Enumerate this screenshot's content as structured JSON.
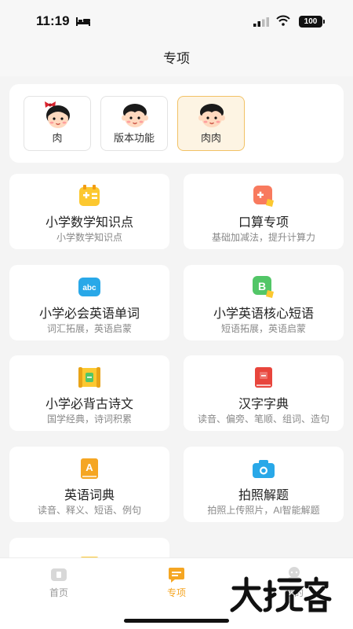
{
  "status_bar": {
    "time": "11:19",
    "battery": "100"
  },
  "nav": {
    "title": "专项"
  },
  "profiles": [
    {
      "label": "肉",
      "gender": "girl",
      "selected": false
    },
    {
      "label": "版本功能",
      "gender": "boy",
      "selected": false
    },
    {
      "label": "肉肉",
      "gender": "boy",
      "selected": true
    }
  ],
  "tiles": [
    {
      "title": "小学数学知识点",
      "subtitle": "小学数学知识点",
      "icon": "math-icon"
    },
    {
      "title": "口算专项",
      "subtitle": "基础加减法，提升计算力",
      "icon": "calc-icon"
    },
    {
      "title": "小学必会英语单词",
      "subtitle": "词汇拓展，英语启蒙",
      "icon": "abc-icon"
    },
    {
      "title": "小学英语核心短语",
      "subtitle": "短语拓展，英语启蒙",
      "icon": "phrase-b-icon"
    },
    {
      "title": "小学必背古诗文",
      "subtitle": "国学经典，诗词积累",
      "icon": "scroll-icon"
    },
    {
      "title": "汉字字典",
      "subtitle": "读音、偏旁、笔顺、组词、造句",
      "icon": "dictionary-icon"
    },
    {
      "title": "英语词典",
      "subtitle": "读音、释义、短语、例句",
      "icon": "english-dictionary-icon"
    },
    {
      "title": "拍照解题",
      "subtitle": "拍照上传照片，AI智能解题",
      "icon": "camera-icon"
    }
  ],
  "tab_bar": {
    "tabs": [
      {
        "label": "首页",
        "icon": "home-icon"
      },
      {
        "label": "专项",
        "icon": "special-icon"
      },
      {
        "label": "我的",
        "icon": "profile-icon"
      }
    ]
  },
  "watermark": {
    "text": "大玩客"
  },
  "colors": {
    "accent": "#f5a623",
    "selected_bg": "#fdf4e3"
  }
}
